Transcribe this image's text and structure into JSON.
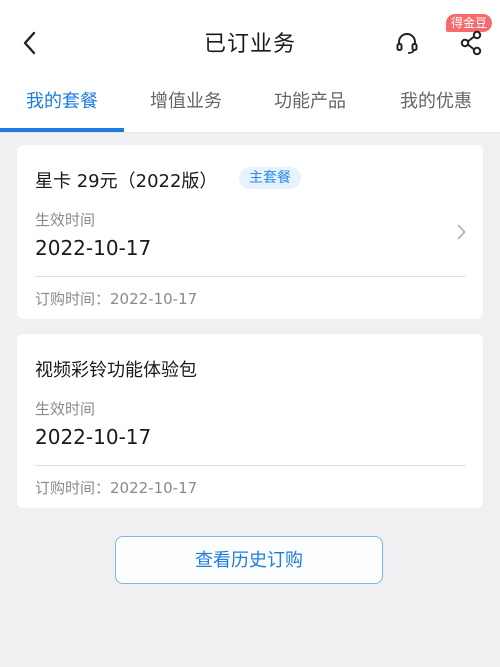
{
  "header": {
    "title": "已订业务",
    "back_icon": "chevron-left-icon",
    "support_icon": "headset-icon",
    "share_icon": "share-icon",
    "coin_badge": "得金豆",
    "coin_badge_color": "#f56b6b"
  },
  "tabs": [
    {
      "label": "我的套餐",
      "active": true
    },
    {
      "label": "增值业务",
      "active": false
    },
    {
      "label": "功能产品",
      "active": false
    },
    {
      "label": "我的优惠",
      "active": false
    }
  ],
  "accent_color": "#1e7be0",
  "cards": [
    {
      "name": "星卡 29元（2022版）",
      "tag": "主套餐",
      "effective_label": "生效时间",
      "effective_date": "2022-10-17",
      "order_text": "订购时间：2022-10-17",
      "has_chevron": true
    },
    {
      "name": "视频彩铃功能体验包",
      "effective_label": "生效时间",
      "effective_date": "2022-10-17",
      "order_text": "订购时间：2022-10-17",
      "has_chevron": false
    }
  ],
  "history_button": "查看历史订购"
}
